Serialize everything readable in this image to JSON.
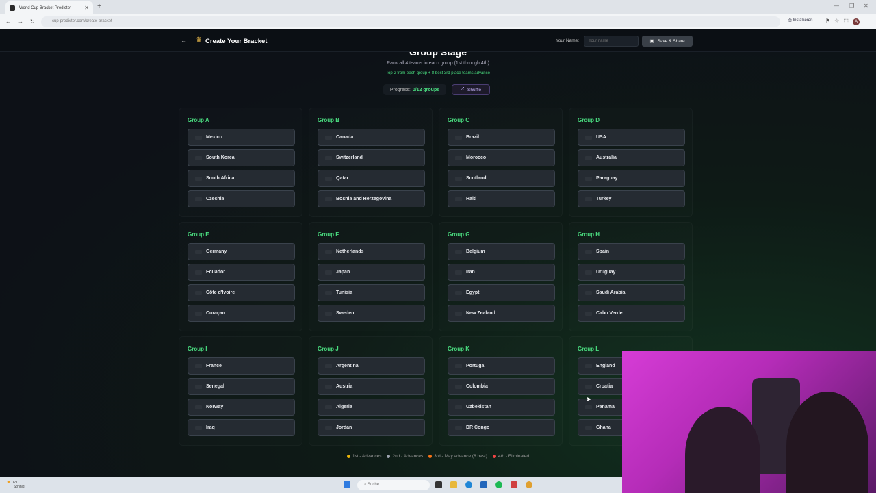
{
  "browser": {
    "tab_title": "World Cup Bracket Predictor",
    "url": "cup-predictor.com/create-bracket",
    "install_label": "Installieren"
  },
  "app": {
    "title": "Create Your Bracket",
    "name_label": "Your Name:",
    "name_placeholder": "Your name",
    "save_label": "Save & Share"
  },
  "stage": {
    "title": "Group Stage",
    "subtitle": "Rank all 4 teams in each group (1st through 4th)",
    "advance_note": "Top 2 from each group + 8 best 3rd place teams advance",
    "progress_label": "Progress:",
    "progress_value": "0/12 groups",
    "shuffle_label": "Shuffle"
  },
  "groups": [
    {
      "name": "Group A",
      "teams": [
        "Mexico",
        "South Korea",
        "South Africa",
        "Czechia"
      ]
    },
    {
      "name": "Group B",
      "teams": [
        "Canada",
        "Switzerland",
        "Qatar",
        "Bosnia and Herzegovina"
      ]
    },
    {
      "name": "Group C",
      "teams": [
        "Brazil",
        "Morocco",
        "Scotland",
        "Haiti"
      ]
    },
    {
      "name": "Group D",
      "teams": [
        "USA",
        "Australia",
        "Paraguay",
        "Turkey"
      ]
    },
    {
      "name": "Group E",
      "teams": [
        "Germany",
        "Ecuador",
        "Côte d'Ivoire",
        "Curaçao"
      ]
    },
    {
      "name": "Group F",
      "teams": [
        "Netherlands",
        "Japan",
        "Tunisia",
        "Sweden"
      ]
    },
    {
      "name": "Group G",
      "teams": [
        "Belgium",
        "Iran",
        "Egypt",
        "New Zealand"
      ]
    },
    {
      "name": "Group H",
      "teams": [
        "Spain",
        "Uruguay",
        "Saudi Arabia",
        "Cabo Verde"
      ]
    },
    {
      "name": "Group I",
      "teams": [
        "France",
        "Senegal",
        "Norway",
        "Iraq"
      ]
    },
    {
      "name": "Group J",
      "teams": [
        "Argentina",
        "Austria",
        "Algeria",
        "Jordan"
      ]
    },
    {
      "name": "Group K",
      "teams": [
        "Portugal",
        "Colombia",
        "Uzbekistan",
        "DR Congo"
      ]
    },
    {
      "name": "Group L",
      "teams": [
        "England",
        "Croatia",
        "Panama",
        "Ghana"
      ]
    }
  ],
  "legend": [
    {
      "label": "1st - Advances",
      "color": "#eab308"
    },
    {
      "label": "2nd - Advances",
      "color": "#9ca3af"
    },
    {
      "label": "3rd - May advance (8 best)",
      "color": "#f97316"
    },
    {
      "label": "4th - Eliminated",
      "color": "#ef4444"
    }
  ],
  "taskbar": {
    "weather_temp": "16°C",
    "weather_desc": "Sonnig",
    "search_placeholder": "Suche"
  }
}
